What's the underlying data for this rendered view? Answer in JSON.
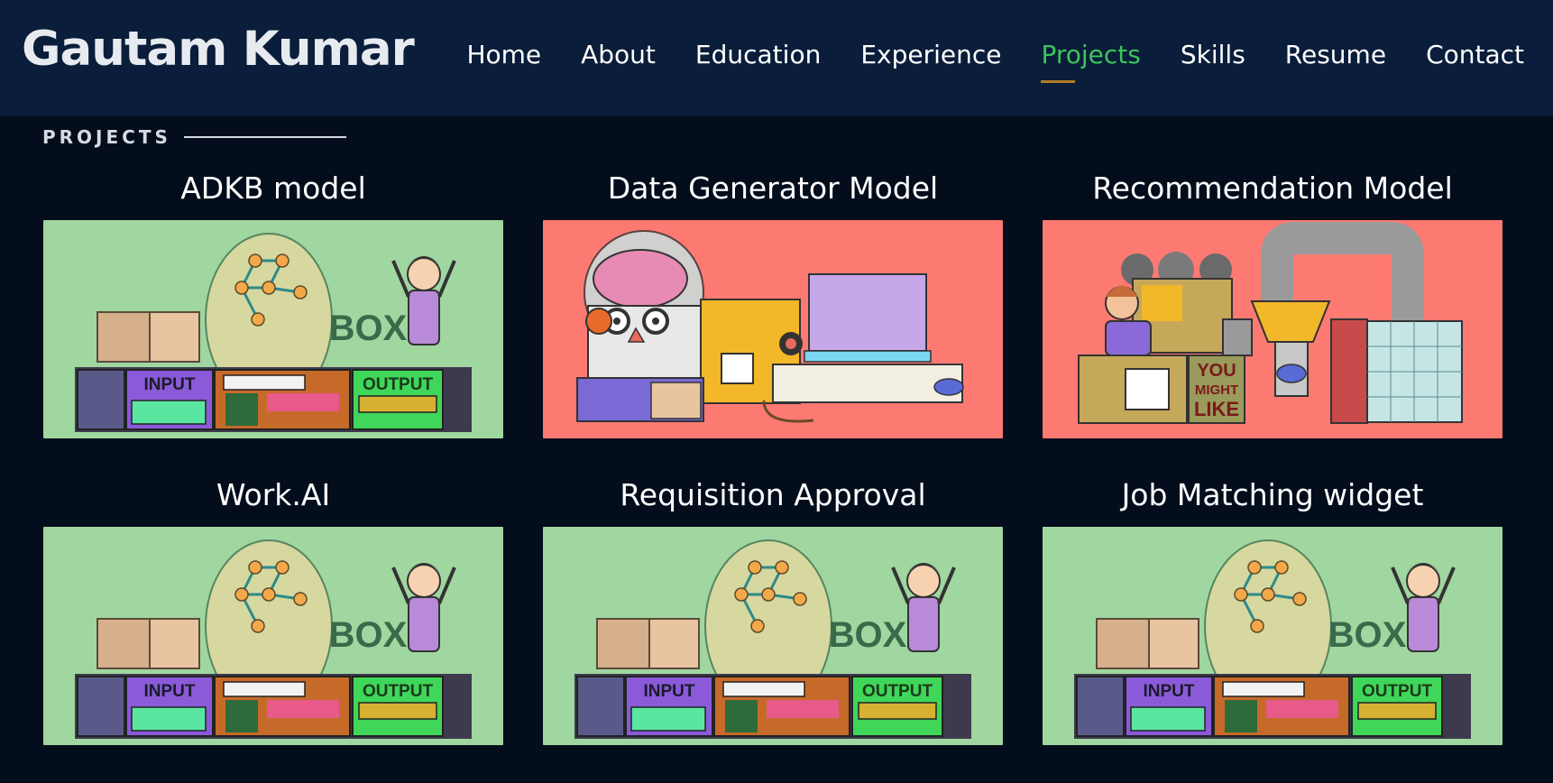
{
  "header": {
    "brand": "Gautam Kumar",
    "nav": [
      "Home",
      "About",
      "Education",
      "Experience",
      "Projects",
      "Skills",
      "Resume",
      "Contact"
    ],
    "active": "Projects",
    "colors": {
      "bar": "#0a1d3a",
      "active": "#3cc45a",
      "underline": "#b07d2a"
    }
  },
  "section": {
    "label": "PROJECTS"
  },
  "projects": [
    {
      "title": "ADKB model",
      "image": "ai-box-illustration",
      "bg": "#a0d6a0",
      "labels": [
        "INPUT",
        "BOX",
        "OUTPUT"
      ]
    },
    {
      "title": "Data Generator Model",
      "image": "robot-brain-computer-illustration",
      "bg": "#fd7a73",
      "labels": []
    },
    {
      "title": "Recommendation Model",
      "image": "recommendation-machine-illustration",
      "bg": "#fd7a73",
      "labels": [
        "YOU",
        "MIGHT",
        "LIKE"
      ]
    },
    {
      "title": "Work.AI",
      "image": "ai-box-illustration",
      "bg": "#a0d6a0",
      "labels": [
        "INPUT",
        "BOX",
        "OUTPUT"
      ]
    },
    {
      "title": "Requisition Approval",
      "image": "ai-box-illustration",
      "bg": "#a0d6a0",
      "labels": [
        "INPUT",
        "BOX",
        "OUTPUT"
      ]
    },
    {
      "title": "Job Matching widget",
      "image": "ai-box-illustration",
      "bg": "#a0d6a0",
      "labels": [
        "INPUT",
        "BOX",
        "OUTPUT"
      ]
    }
  ]
}
